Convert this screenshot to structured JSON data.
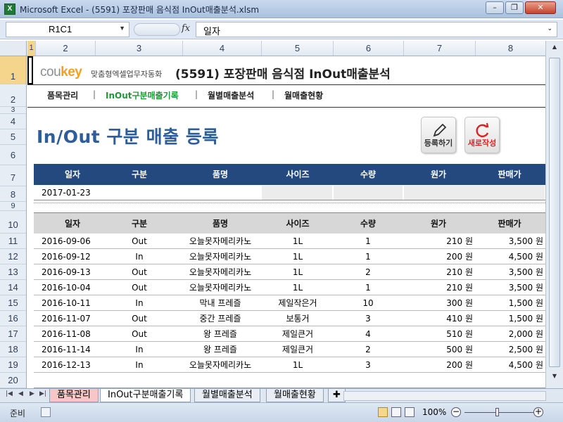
{
  "window": {
    "title": "Microsoft Excel - (5591) 포장판매 음식점 InOut매출분석.xlsm",
    "app_icon": "X",
    "minimize": "–",
    "restore": "❐",
    "close": "✕"
  },
  "formula_bar": {
    "name_box": "R1C1",
    "fx": "fx",
    "content": "일자"
  },
  "columns": [
    "1",
    "2",
    "3",
    "4",
    "5",
    "6",
    "7",
    "8"
  ],
  "rows": [
    "1",
    "2",
    "3",
    "4",
    "5",
    "6",
    "7",
    "8",
    "9",
    "10",
    "11",
    "12",
    "13",
    "14",
    "15",
    "16",
    "17",
    "18",
    "19",
    "20"
  ],
  "header": {
    "logo_prefix": "cou",
    "logo_suffix": "key",
    "tagline": "맞춤형엑셀업무자동화",
    "doc_title": "(5591) 포장판매 음식점 InOut매출분석"
  },
  "nav": {
    "items": [
      "품목관리",
      "InOut구분매출기록",
      "월별매출분석",
      "월매출현황"
    ],
    "separator": "|"
  },
  "page_heading": "In/Out 구분 매출 등록",
  "buttons": {
    "register": "등록하기",
    "new": "새로작성"
  },
  "entry": {
    "headers": [
      "일자",
      "구분",
      "품명",
      "사이즈",
      "수량",
      "원가",
      "판매가"
    ],
    "date": "2017-01-23"
  },
  "list": {
    "headers": [
      "일자",
      "구분",
      "품명",
      "사이즈",
      "수량",
      "원가",
      "판매가"
    ],
    "rows": [
      [
        "2016-09-06",
        "Out",
        "오늘못자메리카노",
        "1L",
        "1",
        "210 원",
        "3,500 원"
      ],
      [
        "2016-09-12",
        "In",
        "오늘못자메리카노",
        "1L",
        "1",
        "200 원",
        "4,500 원"
      ],
      [
        "2016-09-13",
        "Out",
        "오늘못자메리카노",
        "1L",
        "2",
        "210 원",
        "3,500 원"
      ],
      [
        "2016-10-04",
        "Out",
        "오늘못자메리카노",
        "1L",
        "1",
        "210 원",
        "3,500 원"
      ],
      [
        "2016-10-11",
        "In",
        "막내 프레즐",
        "제일작은거",
        "10",
        "300 원",
        "1,500 원"
      ],
      [
        "2016-11-07",
        "Out",
        "중간 프레즐",
        "보통거",
        "3",
        "410 원",
        "1,500 원"
      ],
      [
        "2016-11-08",
        "Out",
        "왕 프레즐",
        "제일큰거",
        "4",
        "510 원",
        "2,000 원"
      ],
      [
        "2016-11-14",
        "In",
        "왕 프레즐",
        "제일큰거",
        "2",
        "500 원",
        "2,500 원"
      ],
      [
        "2016-12-13",
        "In",
        "오늘못자메리카노",
        "1L",
        "3",
        "200 원",
        "4,500 원"
      ]
    ]
  },
  "sheet_tabs": [
    "품목관리",
    "InOut구분매출기록",
    "월별매출분석",
    "월매출현황"
  ],
  "status": {
    "ready": "준비",
    "zoom": "100%",
    "zoom_minus": "−",
    "zoom_plus": "+"
  }
}
